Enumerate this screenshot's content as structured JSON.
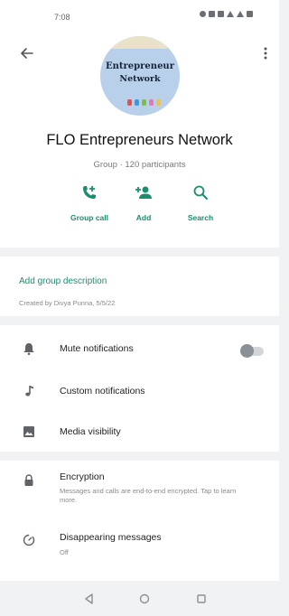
{
  "status_bar": {
    "time": "7:08"
  },
  "header": {
    "avatar_text_line1": "Entrepreneur",
    "avatar_text_line2": "Network",
    "group_name": "FLO Entrepreneurs Network",
    "group_subtitle": "Group · 120 participants"
  },
  "actions": [
    {
      "label": "Group call",
      "icon": "add-call-icon"
    },
    {
      "label": "Add",
      "icon": "add-person-icon"
    },
    {
      "label": "Search",
      "icon": "search-icon"
    }
  ],
  "description": {
    "add_link": "Add group description",
    "created_by": "Created by Divya Punna, 5/5/22"
  },
  "notifications": [
    {
      "label": "Mute notifications",
      "icon": "bell-icon",
      "toggle_on": false
    },
    {
      "label": "Custom notifications",
      "icon": "music-note-icon"
    },
    {
      "label": "Media visibility",
      "icon": "image-icon"
    }
  ],
  "encryption": {
    "title": "Encryption",
    "description": "Messages and calls are end-to-end encrypted. Tap to learn more.",
    "icon": "lock-icon"
  },
  "disappearing": {
    "title": "Disappearing messages",
    "value": "Off",
    "icon": "timer-icon"
  },
  "colors": {
    "accent": "#1a8f6e",
    "background": "#f0f2f4",
    "card": "#ffffff"
  }
}
